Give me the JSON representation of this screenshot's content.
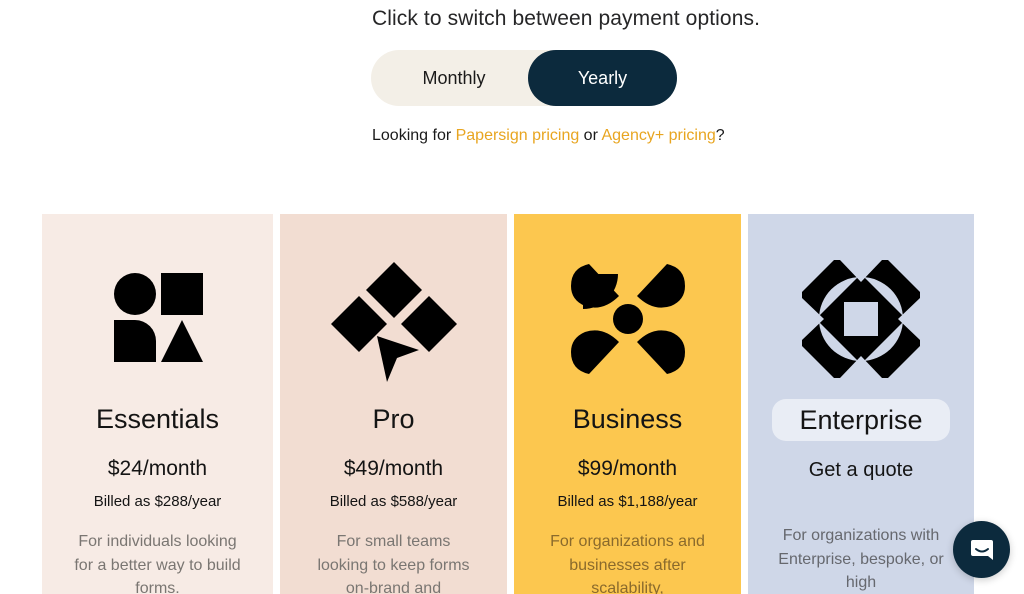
{
  "prompt": "Click to switch between payment options.",
  "toggle": {
    "monthly": "Monthly",
    "yearly": "Yearly",
    "selected": "Yearly"
  },
  "looking": {
    "prefix": "Looking for ",
    "link1": "Papersign pricing",
    "middle": " or ",
    "link2": "Agency+ pricing",
    "suffix": "?"
  },
  "plans": [
    {
      "name": "Essentials",
      "price": "$24/month",
      "billed": "Billed as $288/year",
      "desc": "For individuals looking for a better way to build forms.",
      "icon": "shapes-icon",
      "bg": "#f7ebe5"
    },
    {
      "name": "Pro",
      "price": "$49/month",
      "billed": "Billed as $588/year",
      "desc": "For small teams looking to keep forms on-brand and",
      "icon": "diamonds-pointer-icon",
      "bg": "#f2ddd2"
    },
    {
      "name": "Business",
      "price": "$99/month",
      "billed": "Billed as $1,188/year",
      "desc": "For organizations and businesses after scalability,",
      "icon": "flower-icon",
      "bg": "#fcc74f"
    },
    {
      "name": "Enterprise",
      "quote": "Get a quote",
      "desc": "For organizations with Enterprise, bespoke, or high",
      "icon": "octagon-frame-icon",
      "bg": "#cfd7e8"
    }
  ],
  "colors": {
    "accent": "#e8a520",
    "navy": "#0c2a3d"
  },
  "chat": {
    "icon": "chat-bubble-icon"
  }
}
